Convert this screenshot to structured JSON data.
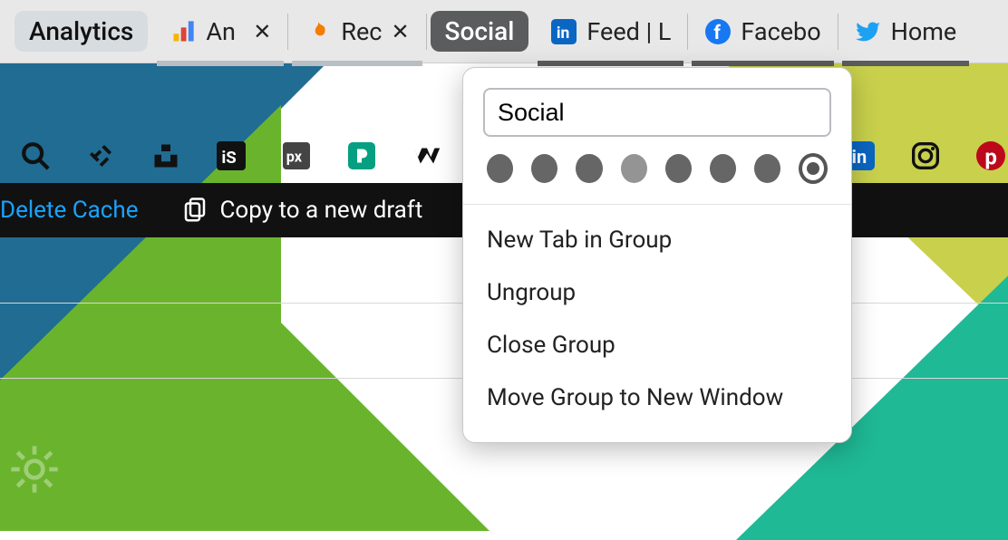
{
  "tabstrip": {
    "group1_label": "Analytics",
    "tab1_title": "An",
    "tab2_title": "Rec",
    "group2_label": "Social",
    "tab3_title": "Feed | L",
    "tab4_title": "Facebo",
    "tab5_title": "Home"
  },
  "actionbar": {
    "delete_cache_label": "Delete Cache",
    "copy_draft_label": "Copy to a new draft"
  },
  "popover": {
    "name_value": "Social",
    "menu_new_tab": "New Tab in Group",
    "menu_ungroup": "Ungroup",
    "menu_close_group": "Close Group",
    "menu_move_window": "Move Group to New Window"
  }
}
